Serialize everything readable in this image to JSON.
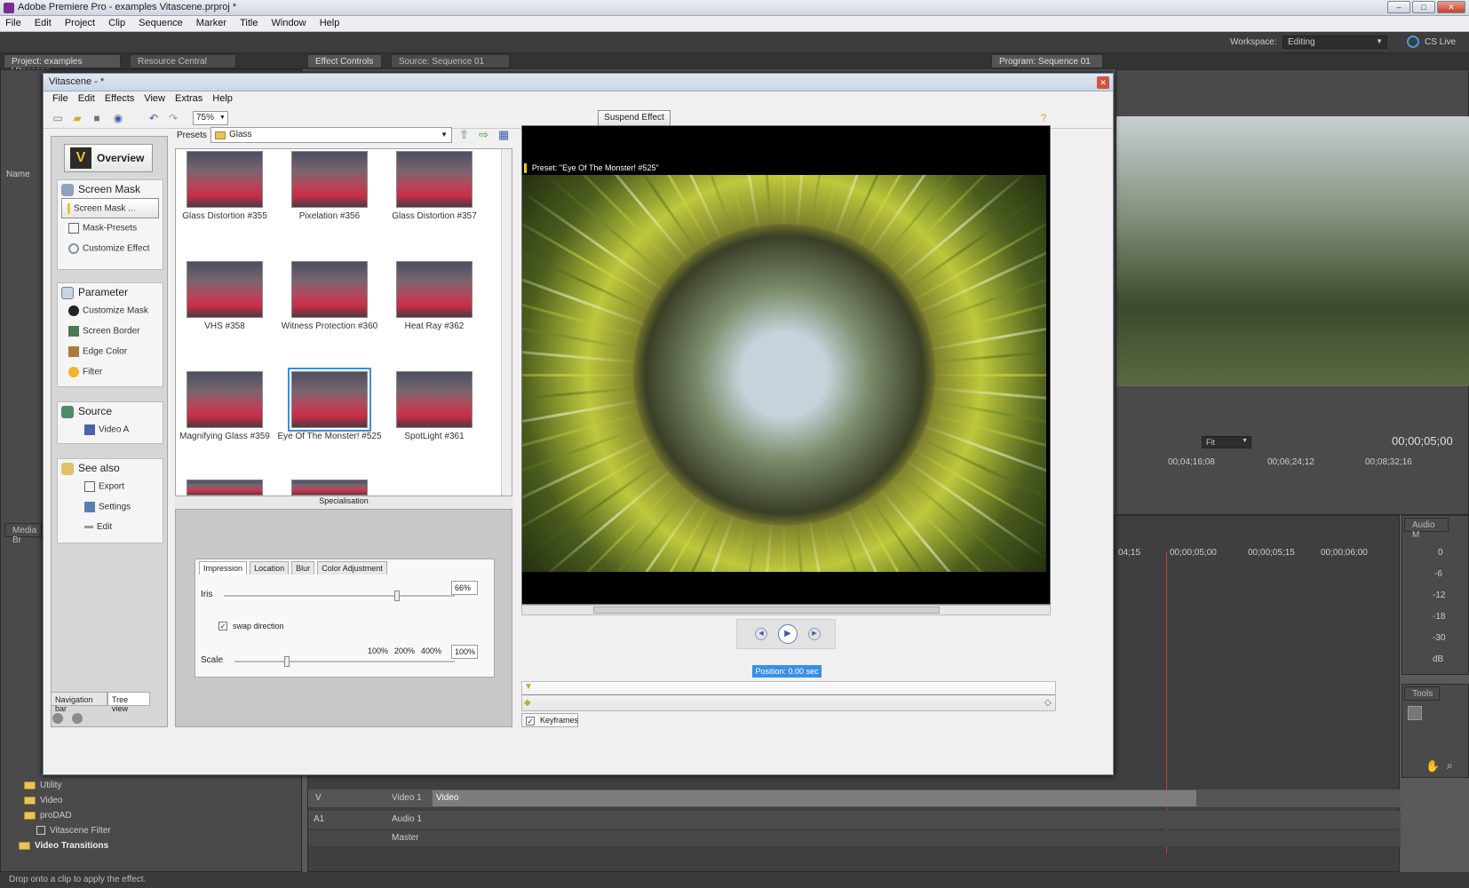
{
  "app": {
    "title": "Adobe Premiere Pro - examples Vitascene.prproj *",
    "menu": [
      "File",
      "Edit",
      "Project",
      "Clip",
      "Sequence",
      "Marker",
      "Title",
      "Window",
      "Help"
    ],
    "workspace_label": "Workspace:",
    "workspace_value": "Editing",
    "cs_live": "CS Live"
  },
  "panels": {
    "project_tab": "Project: examples Vitascene",
    "resource_tab": "Resource Central",
    "effect_controls_tab": "Effect Controls",
    "source_tab": "Source: Sequence 01",
    "program_tab": "Program: Sequence 01",
    "name_col": "Name",
    "media_tab": "Media Br",
    "audio_tab": "Audio M",
    "tools_tab": "Tools",
    "fit": "Fit",
    "timecode": "00;00;05;00",
    "ruler_marks": [
      "00;04;16;08",
      "00;06;24;12",
      "00;08;32;16"
    ],
    "timeline_marks": [
      "04;15",
      "00;00;05;00",
      "00;00;05;15",
      "00;00;06;00"
    ],
    "audio_meter": [
      "0",
      "-6",
      "-12",
      "-18",
      "-30",
      "dB"
    ],
    "tracks": {
      "video_label": "V",
      "video1": "Video 1",
      "video_clip": "Video",
      "audio_label": "A1",
      "audio1": "Audio 1",
      "master": "Master"
    },
    "project_items": [
      "Utility",
      "Video",
      "proDAD",
      "Vitascene Filter",
      "Video Transitions"
    ],
    "status": "Drop onto a clip to apply the effect."
  },
  "dialog": {
    "title": "Vitascene - *",
    "menu": [
      "File",
      "Edit",
      "Effects",
      "View",
      "Extras",
      "Help"
    ],
    "zoom": "75%",
    "suspend": "Suspend Effect",
    "nav": {
      "overview": "Overview",
      "screen_mask_head": "Screen Mask",
      "screen_mask_btn": "Screen Mask ...",
      "mask_presets": "Mask-Presets",
      "customize_effect": "Customize Effect",
      "parameter_head": "Parameter",
      "customize_mask": "Customize Mask",
      "screen_border": "Screen Border",
      "edge_color": "Edge Color",
      "filter": "Filter",
      "source_head": "Source",
      "video_a": "Video A",
      "see_also_head": "See also",
      "export": "Export",
      "settings": "Settings",
      "edit": "Edit",
      "tab_nav": "Navigation bar",
      "tab_tree": "Tree view"
    },
    "presets_label": "Presets",
    "presets_value": "Glass",
    "preset_items": [
      "Glass Distortion #355",
      "Pixelation #356",
      "Glass Distortion #357",
      "VHS #358",
      "Witness Protection #360",
      "Heat Ray #362",
      "Magnifying Glass #359",
      "Eye Of The Monster! #525",
      "SpotLight #361"
    ],
    "specialisation": "Specialisation",
    "param_tabs": [
      "Impression",
      "Location",
      "Blur",
      "Color Adjustment"
    ],
    "iris_label": "Iris",
    "iris_value": "66%",
    "swap_label": "swap direction",
    "scale_label": "Scale",
    "scale_marks": [
      "100%",
      "200%",
      "400%"
    ],
    "scale_value": "100%",
    "preview_caption": "Preset: \"Eye Of The Monster! #525\"",
    "position": "Position: 0.00 sec",
    "keyframes": "Keyframes"
  }
}
